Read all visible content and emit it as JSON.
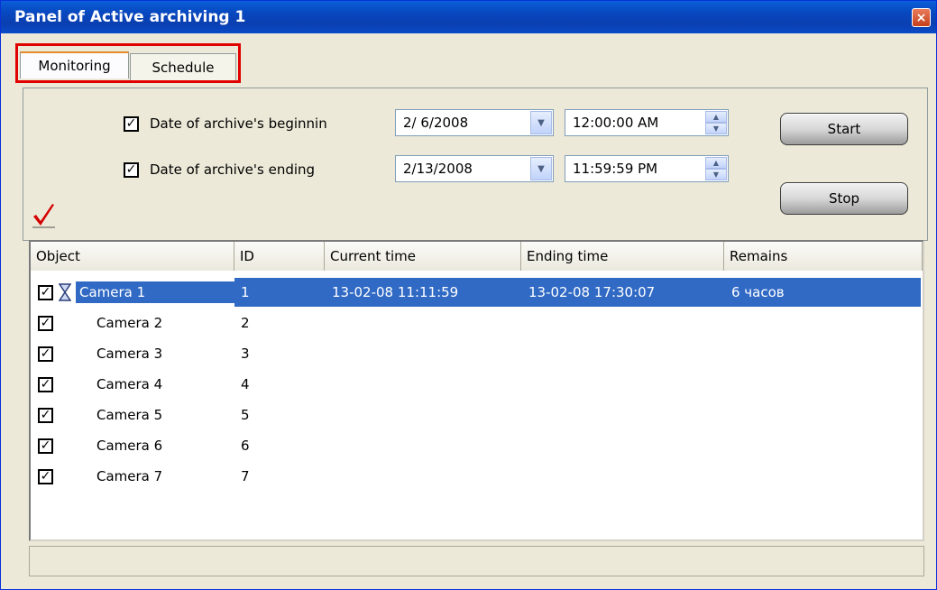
{
  "window": {
    "title": "Panel of Active archiving 1",
    "close_label": "×"
  },
  "tabs": [
    {
      "label": "Monitoring",
      "active": true
    },
    {
      "label": "Schedule",
      "active": false
    }
  ],
  "controls": {
    "begin_label": "Date of archive's beginnin",
    "begin_checked": true,
    "begin_date": "2/  6/2008",
    "begin_time": "12:00:00 AM",
    "end_label": "Date of archive's ending",
    "end_checked": true,
    "end_date": "2/13/2008",
    "end_time": "11:59:59 PM",
    "start_label": "Start",
    "stop_label": "Stop",
    "checkmark_icon": "red-checkmark-icon"
  },
  "table": {
    "columns": [
      "Object",
      "ID",
      "Current time",
      "Ending time",
      "Remains"
    ],
    "rows": [
      {
        "checked": true,
        "icon": "hourglass-icon",
        "object": "Camera 1",
        "id": "1",
        "current": "13-02-08 11:11:59",
        "ending": "13-02-08 17:30:07",
        "remains": "6 часов",
        "selected": true
      },
      {
        "checked": true,
        "object": "Camera 2",
        "id": "2",
        "current": "",
        "ending": "",
        "remains": ""
      },
      {
        "checked": true,
        "object": "Camera 3",
        "id": "3",
        "current": "",
        "ending": "",
        "remains": ""
      },
      {
        "checked": true,
        "object": "Camera 4",
        "id": "4",
        "current": "",
        "ending": "",
        "remains": ""
      },
      {
        "checked": true,
        "object": "Camera 5",
        "id": "5",
        "current": "",
        "ending": "",
        "remains": ""
      },
      {
        "checked": true,
        "object": "Camera 6",
        "id": "6",
        "current": "",
        "ending": "",
        "remains": ""
      },
      {
        "checked": true,
        "object": "Camera 7",
        "id": "7",
        "current": "",
        "ending": "",
        "remains": ""
      }
    ]
  },
  "colors": {
    "title_bar": "#0a4ac8",
    "selection": "#316ac5",
    "highlight_box": "#e00000"
  }
}
